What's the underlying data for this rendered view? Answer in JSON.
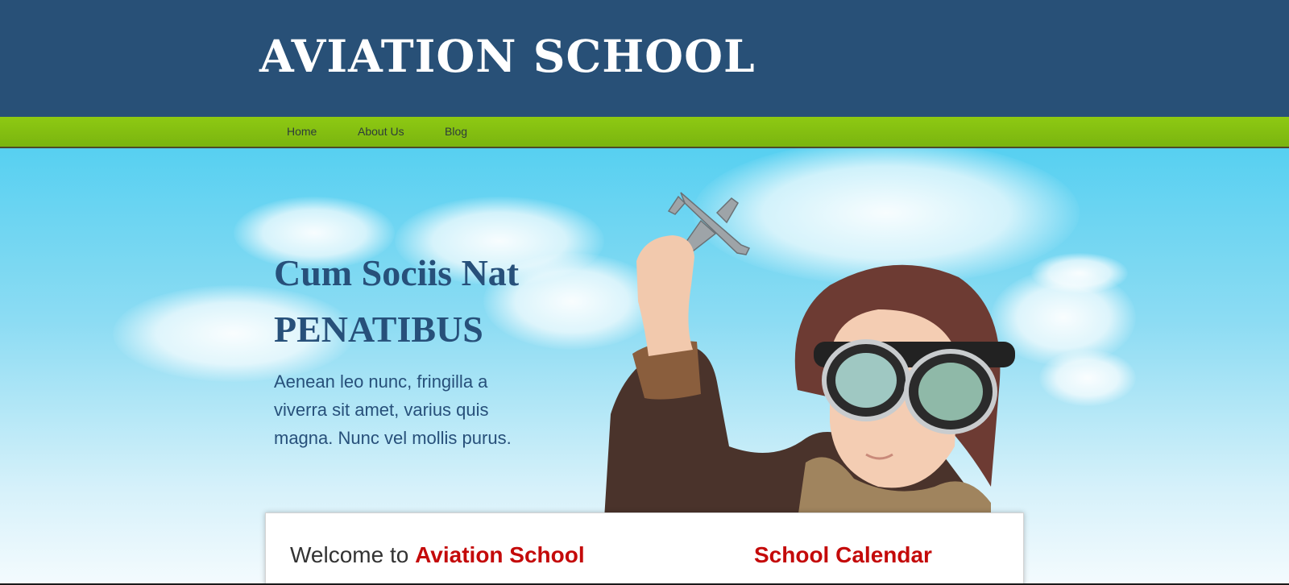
{
  "site": {
    "title": "AVIATION SCHOOL"
  },
  "nav": {
    "items": [
      {
        "label": "Home"
      },
      {
        "label": "About Us"
      },
      {
        "label": "Blog"
      }
    ]
  },
  "hero": {
    "heading_line1": "Cum Sociis Nat",
    "heading_line2": "PENATIBUS",
    "text": "Aenean leo nunc, fringilla a viverra sit amet, varius quis magna. Nunc vel mollis purus.",
    "image": "boy-pilot-with-toy-airplane"
  },
  "content": {
    "welcome_prefix": "Welcome to",
    "welcome_accent": "Aviation School",
    "calendar_title": "School Calendar"
  },
  "colors": {
    "header_bg": "#285077",
    "nav_bg": "#7ab510",
    "accent_red": "#c40a0a",
    "hero_text": "#27507a"
  }
}
